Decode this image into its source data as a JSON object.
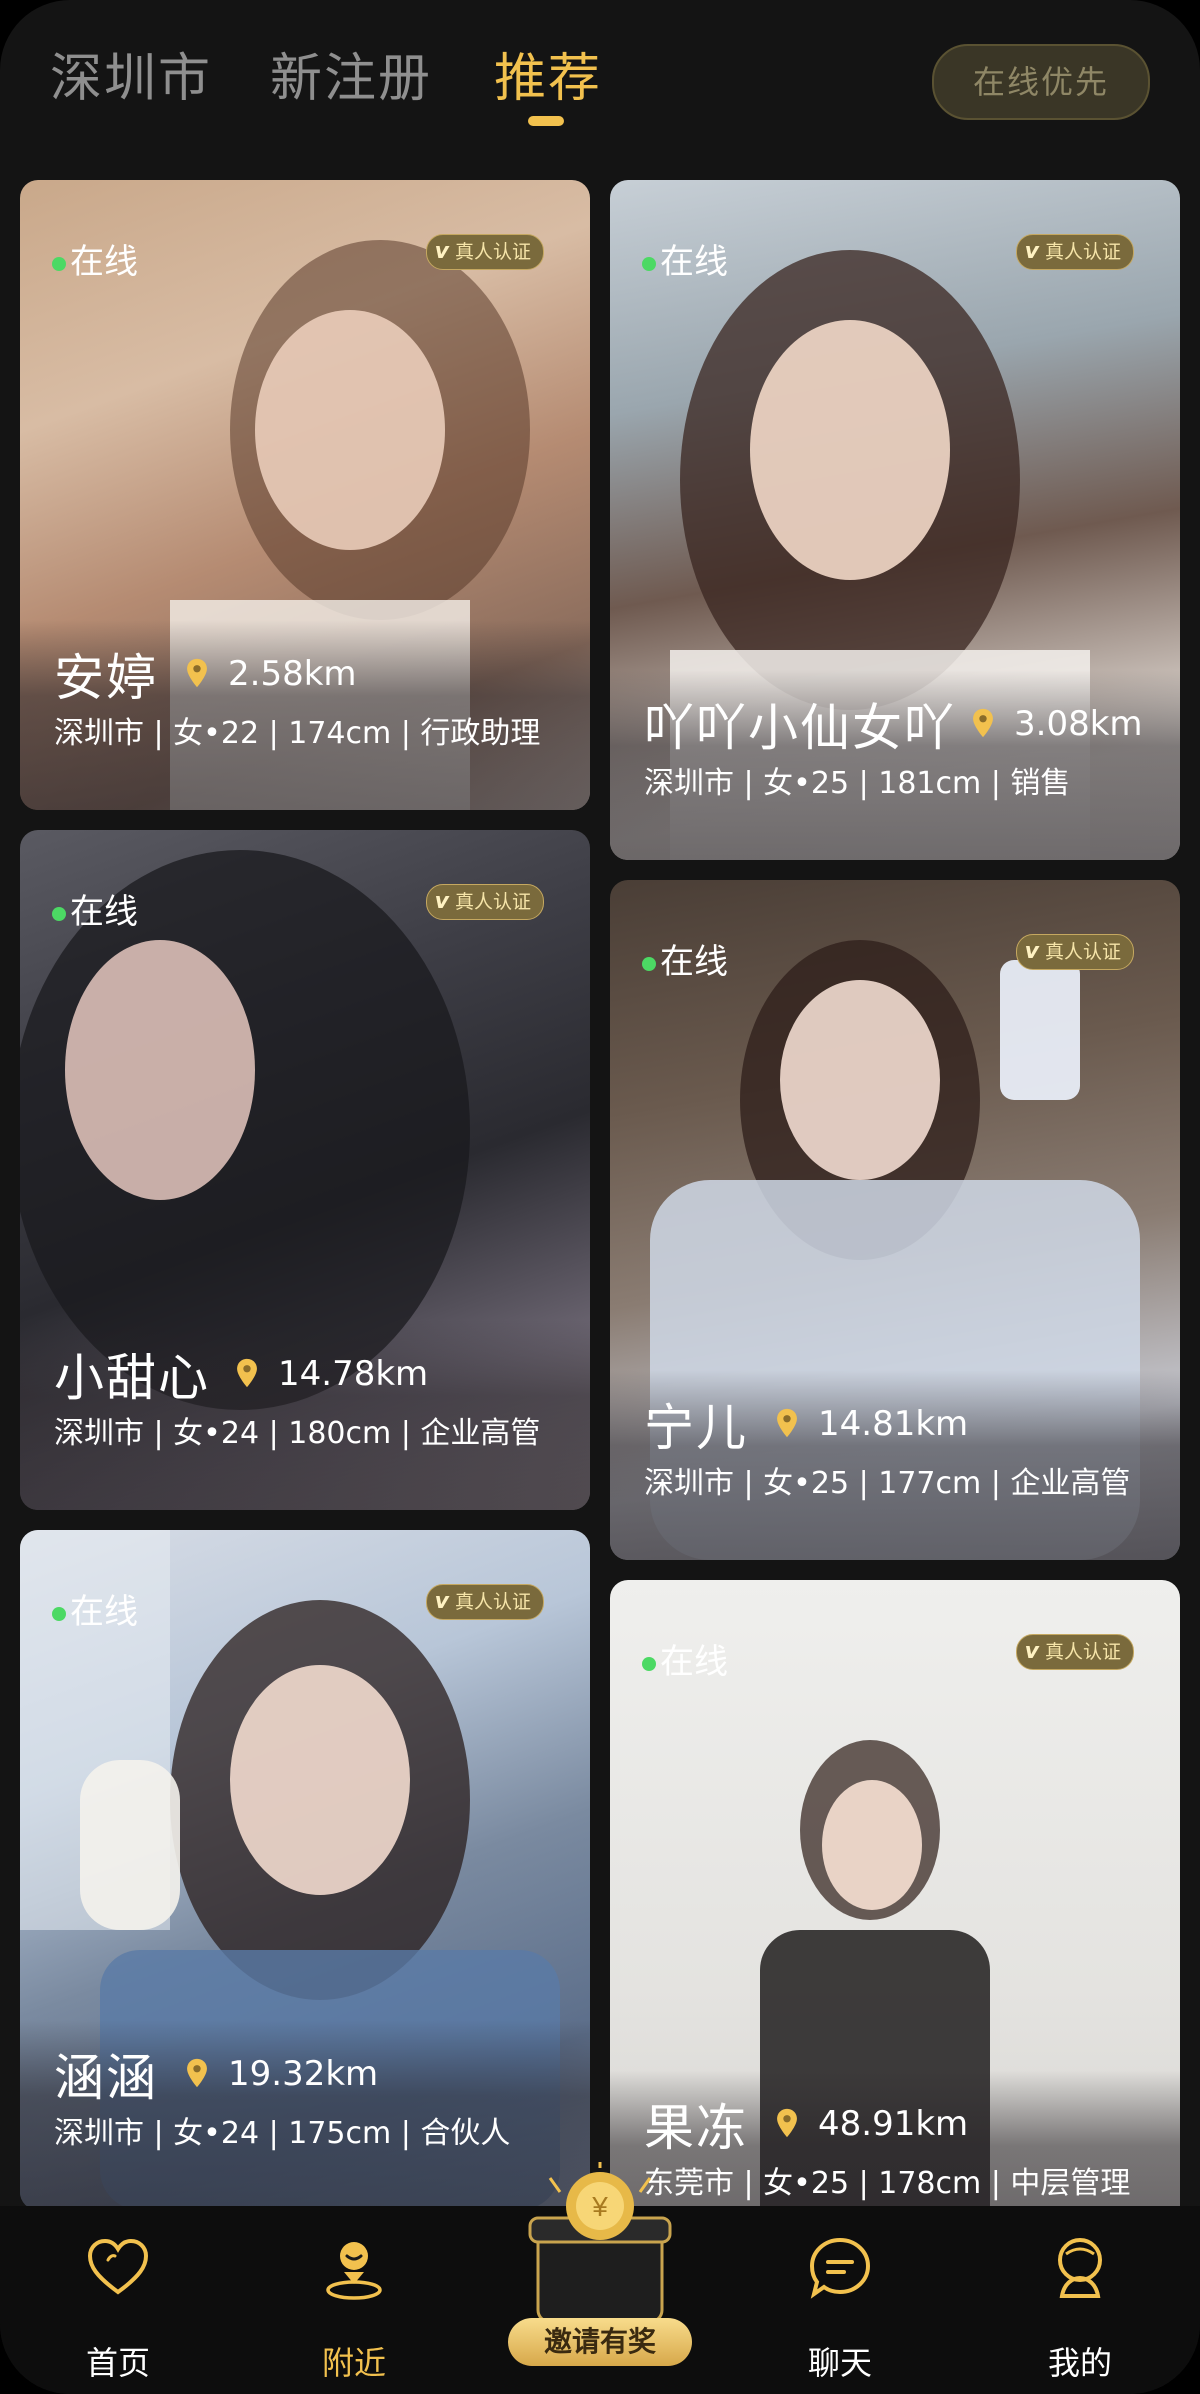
{
  "header": {
    "tabs": [
      "深圳市",
      "新注册",
      "推荐"
    ],
    "active_tab": "推荐",
    "online_first": "在线优先"
  },
  "cards": [
    {
      "name": "安婷",
      "distance": "2.58km",
      "meta": "深圳市 | 女•22 | 174cm | 行政助理",
      "status": "在线",
      "badge": "真人认证"
    },
    {
      "name": "吖吖小仙女吖",
      "distance": "3.08km",
      "meta": "深圳市 | 女•25 | 181cm | 销售",
      "status": "在线",
      "badge": "真人认证"
    },
    {
      "name": "小甜心",
      "distance": "14.78km",
      "meta": "深圳市 | 女•24 | 180cm | 企业高管",
      "status": "在线",
      "badge": "真人认证"
    },
    {
      "name": "宁儿",
      "distance": "14.81km",
      "meta": "深圳市 | 女•25 | 177cm | 企业高管",
      "status": "在线",
      "badge": "真人认证"
    },
    {
      "name": "涵涵",
      "distance": "19.32km",
      "meta": "深圳市 | 女•24 | 175cm | 合伙人",
      "status": "在线",
      "badge": "真人认证"
    },
    {
      "name": "果冻",
      "distance": "48.91km",
      "meta": "东莞市 | 女•25 | 178cm | 中层管理",
      "status": "在线",
      "badge": "真人认证"
    }
  ],
  "bottom_nav": {
    "items": [
      "首页",
      "附近",
      "邀请有奖",
      "聊天",
      "我的"
    ],
    "active": "附近"
  },
  "colors": {
    "accent": "#f2c14e",
    "background": "#141414",
    "online": "#4cd964"
  }
}
